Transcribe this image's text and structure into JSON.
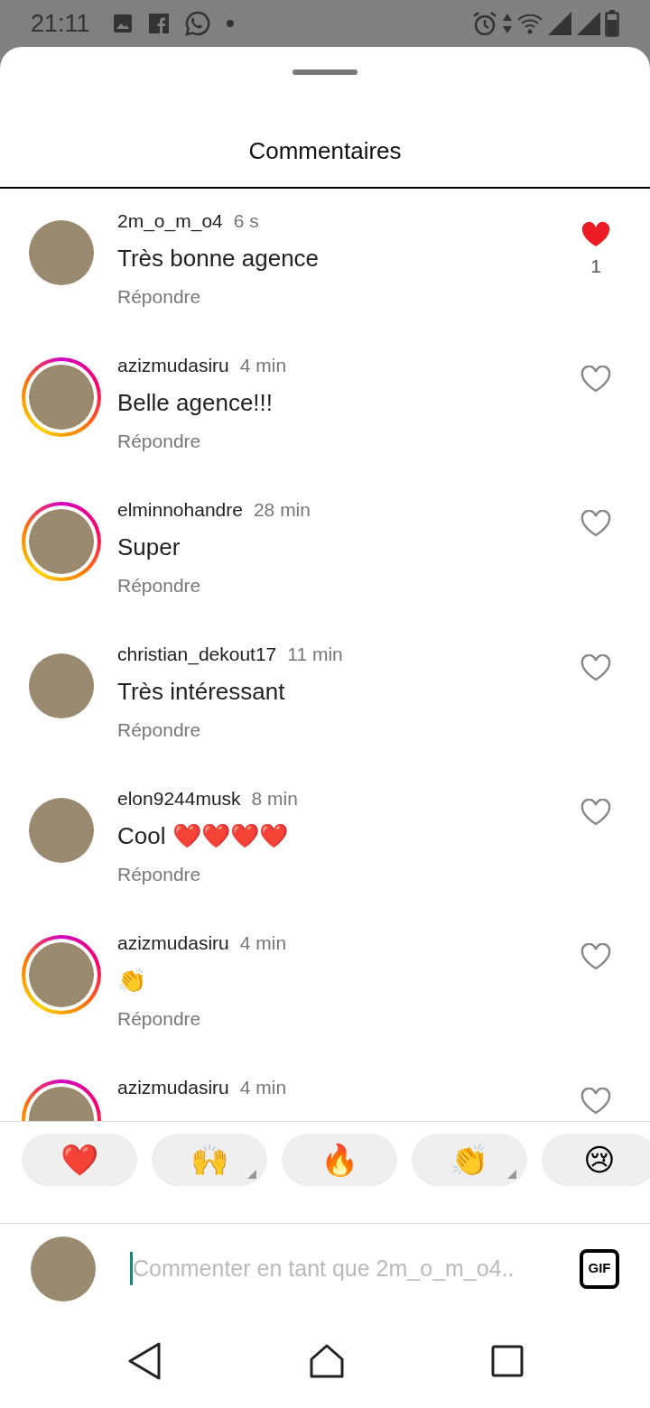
{
  "status_bar": {
    "time": "21:11"
  },
  "sheet": {
    "title": "Commentaires"
  },
  "comments": [
    {
      "username": "2m_o_m_o4",
      "time": "6 s",
      "text": "Très bonne agence",
      "reply": "Répondre",
      "story": false,
      "liked": true,
      "likes": "1"
    },
    {
      "username": "azizmudasiru",
      "time": "4 min",
      "text": "Belle agence!!!",
      "reply": "Répondre",
      "story": true,
      "liked": false
    },
    {
      "username": "elminnohandre",
      "time": "28 min",
      "text": "Super",
      "reply": "Répondre",
      "story": true,
      "liked": false
    },
    {
      "username": "christian_dekout17",
      "time": "11 min",
      "text": "Très intéressant",
      "reply": "Répondre",
      "story": false,
      "liked": false
    },
    {
      "username": "elon9244musk",
      "time": "8 min",
      "text": "Cool ❤️❤️❤️❤️",
      "reply": "Répondre",
      "story": false,
      "liked": false
    },
    {
      "username": "azizmudasiru",
      "time": "4 min",
      "text": "👏",
      "reply": "Répondre",
      "story": true,
      "liked": false
    },
    {
      "username": "azizmudasiru",
      "time": "4 min",
      "story": true,
      "liked": false
    }
  ],
  "reactions": [
    {
      "emoji": "❤️",
      "variants": false
    },
    {
      "emoji": "🙌",
      "variants": true
    },
    {
      "emoji": "🔥",
      "variants": false
    },
    {
      "emoji": "👏",
      "variants": true
    },
    {
      "emoji": "😢",
      "variants": false
    }
  ],
  "composer": {
    "placeholder": "Commenter en tant que 2m_o_m_o4..",
    "gif": "GIF"
  }
}
